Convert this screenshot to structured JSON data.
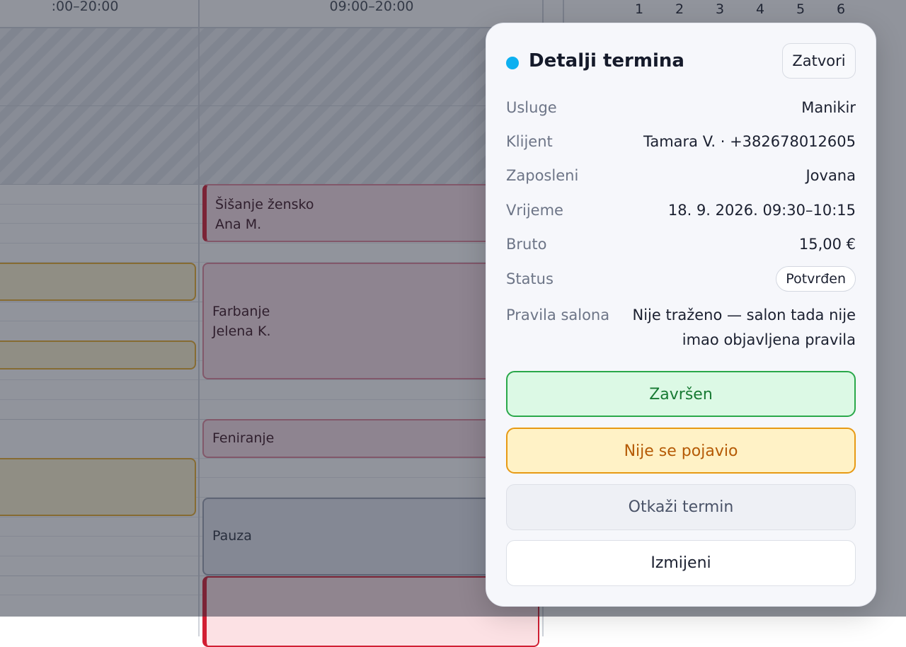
{
  "calendar": {
    "columns": [
      {
        "hours": ":00–20:00"
      },
      {
        "hours": "09:00–20:00"
      }
    ],
    "mini_calendar_days": [
      "1",
      "2",
      "3",
      "4",
      "5",
      "6"
    ],
    "events": [
      {
        "service": "Šišanje žensko",
        "client": "Ana M."
      },
      {
        "service": "Farbanje",
        "client": "Jelena K."
      },
      {
        "service": "Feniranje",
        "client": ""
      },
      {
        "service": "Pauza",
        "client": ""
      }
    ]
  },
  "details": {
    "title": "Detalji termina",
    "status_dot_color": "#0db0f0",
    "close_label": "Zatvori",
    "fields": {
      "services": {
        "label": "Usluge",
        "value": "Manikir"
      },
      "client": {
        "label": "Klijent",
        "value": "Tamara V. · +382678012605"
      },
      "employee": {
        "label": "Zaposleni",
        "value": "Jovana"
      },
      "time": {
        "label": "Vrijeme",
        "value": "18. 9. 2026. 09:30–10:15"
      },
      "gross": {
        "label": "Bruto",
        "value": "15,00 €"
      },
      "status": {
        "label": "Status",
        "value": "Potvrđen"
      },
      "rules": {
        "label": "Pravila salona",
        "value": "Nije traženo — salon tada nije imao objavljena pravila"
      }
    },
    "actions": {
      "done": "Završen",
      "no_show": "Nije se pojavio",
      "cancel": "Otkaži termin",
      "edit": "Izmijeni"
    }
  }
}
